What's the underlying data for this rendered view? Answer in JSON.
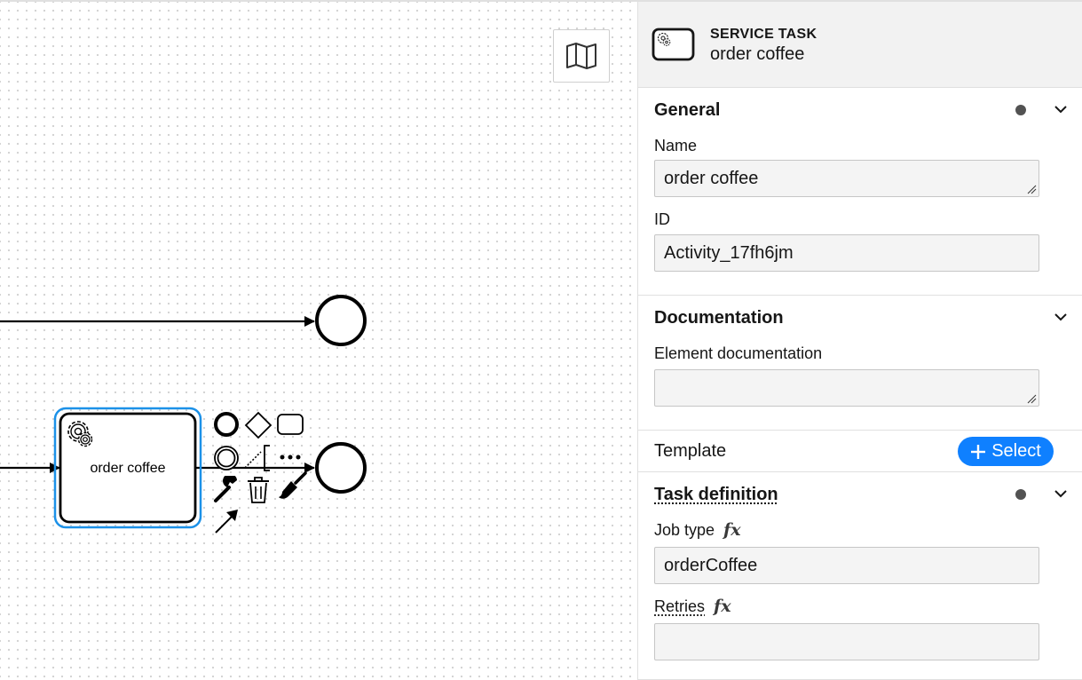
{
  "canvas": {
    "task": {
      "label": "order coffee",
      "icon": "gear-icon"
    },
    "minimap_icon": "map-icon",
    "context_pad": [
      "end-event-icon",
      "gateway-icon",
      "task-icon",
      "intermediate-event-icon",
      "text-annotation-icon",
      "more-icon",
      "wrench-icon",
      "trash-icon",
      "paint-brush-icon",
      "connect-arrow-icon"
    ],
    "selection_color": "#1c91e8"
  },
  "panel": {
    "header": {
      "type": "SERVICE TASK",
      "name": "order coffee",
      "icon": "service-task-icon"
    },
    "general": {
      "title": "General",
      "name_label": "Name",
      "name_value": "order coffee",
      "id_label": "ID",
      "id_value": "Activity_17fh6jm"
    },
    "documentation": {
      "title": "Documentation",
      "element_doc_label": "Element documentation",
      "element_doc_value": ""
    },
    "template": {
      "label": "Template",
      "button_label": "Select",
      "button_color": "#0f80ff"
    },
    "task_definition": {
      "title": "Task definition",
      "job_type_label": "Job type",
      "job_type_value": "orderCoffee",
      "retries_label": "Retries",
      "retries_value": "",
      "fx_symbol": "fx"
    }
  }
}
